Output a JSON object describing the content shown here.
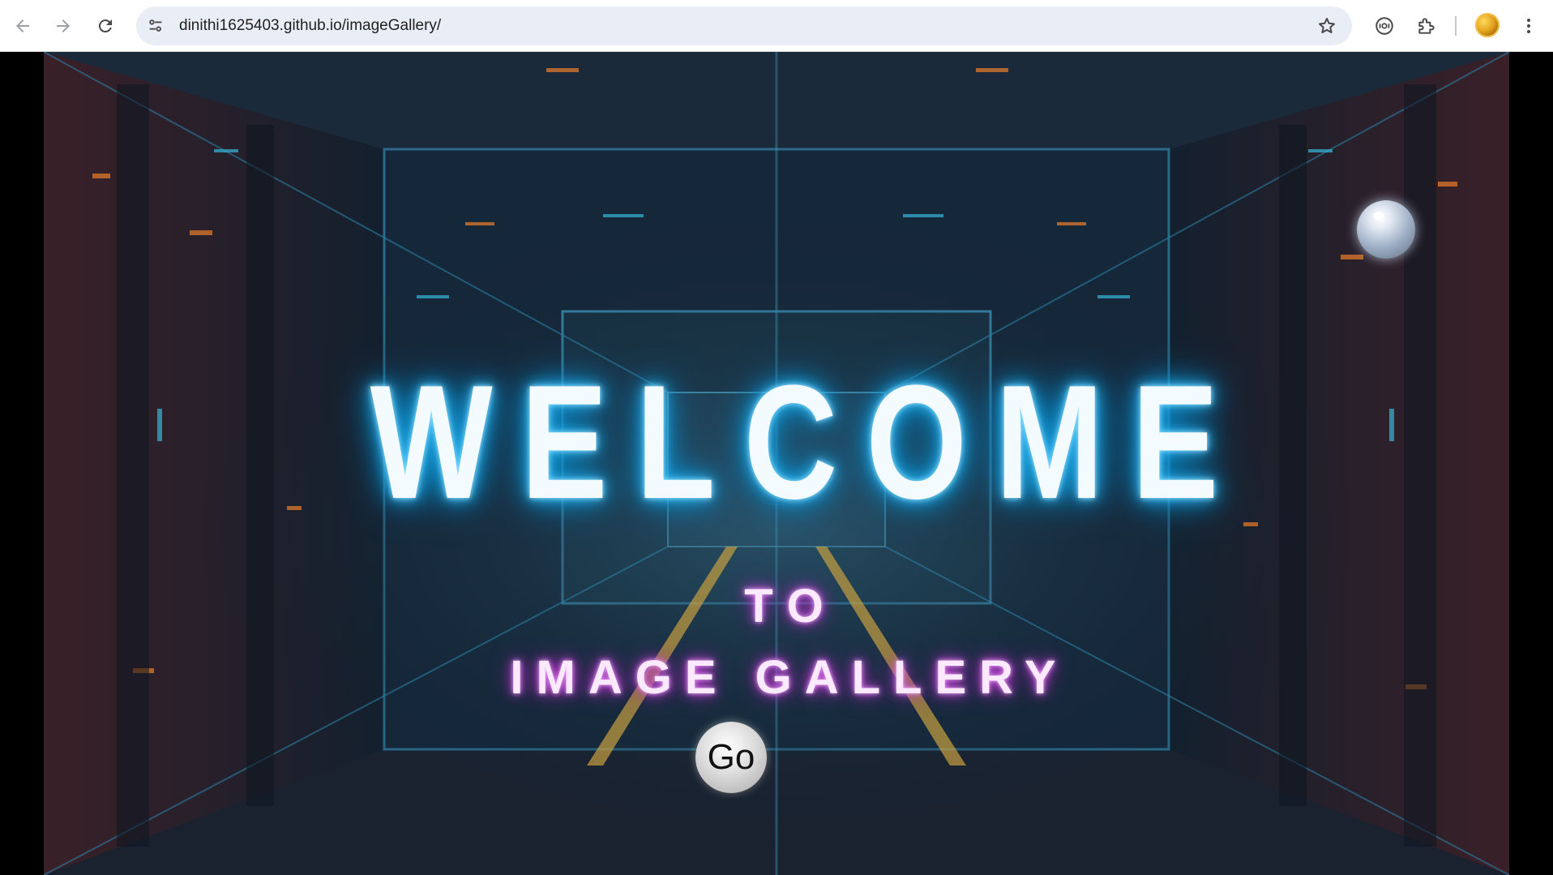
{
  "browser": {
    "url": "dinithi1625403.github.io/imageGallery/",
    "icons": {
      "back": "arrow-left-icon",
      "forward": "arrow-right-icon",
      "reload": "reload-icon",
      "site_info": "tune-icon",
      "bookmark": "star-icon",
      "lens": "lens-icon",
      "extensions": "puzzle-icon",
      "profile": "avatar",
      "menu": "more-vertical-icon"
    }
  },
  "hero": {
    "welcome": "WELCOME",
    "to": "TO",
    "gallery": "IMAGE GALLERY",
    "go_label": "Go"
  },
  "colors": {
    "welcome_glow": "#38bdf8",
    "subtitle_glow": "#d946ef",
    "background": "#162636"
  }
}
